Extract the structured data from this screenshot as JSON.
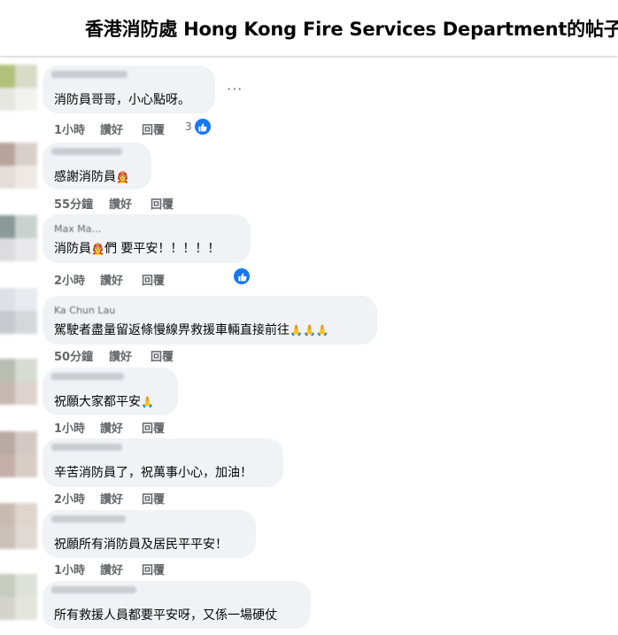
{
  "header": {
    "title": "香港消防處 Hong Kong Fire Services Department的帖子"
  },
  "colors": {
    "bubble": "#f0f2f5",
    "meta_text": "#65676b",
    "like_blue": "#1877f2"
  },
  "comments": [
    {
      "text": "消防員哥哥，小心點呀。",
      "time": "1小時",
      "like": "讚好",
      "reply": "回覆",
      "reaction_count": "3"
    },
    {
      "text": "感謝消防員",
      "time": "55分鐘",
      "like": "讚好",
      "reply": "回覆"
    },
    {
      "author": "Max Ma…",
      "text_before": "消防員",
      "text_after": "們 要平安！！！！！",
      "time": "2小時",
      "like": "讚好",
      "reply": "回覆"
    },
    {
      "author": "Ka Chun Lau",
      "text": "駕駛者盡量留返條慢線畀救援車輛直接前往",
      "time": "50分鐘",
      "like": "讚好",
      "reply": "回覆"
    },
    {
      "text": "祝願大家都平安",
      "time": "1小時",
      "like": "讚好",
      "reply": "回覆"
    },
    {
      "text": "辛苦消防員了，祝萬事小心，加油！",
      "time": "2小時",
      "like": "讚好",
      "reply": "回覆"
    },
    {
      "text": "祝願所有消防員及居民平平安！",
      "time": "1小時",
      "like": "讚好",
      "reply": "回覆"
    },
    {
      "text": "所有救援人員都要平安呀，又係一場硬仗"
    }
  ],
  "icons": {
    "more": "more-options-icon",
    "like": "like-thumb-icon",
    "firefighter_emoji": "firefighter-emoji",
    "pray_emoji": "folded-hands-emoji"
  }
}
